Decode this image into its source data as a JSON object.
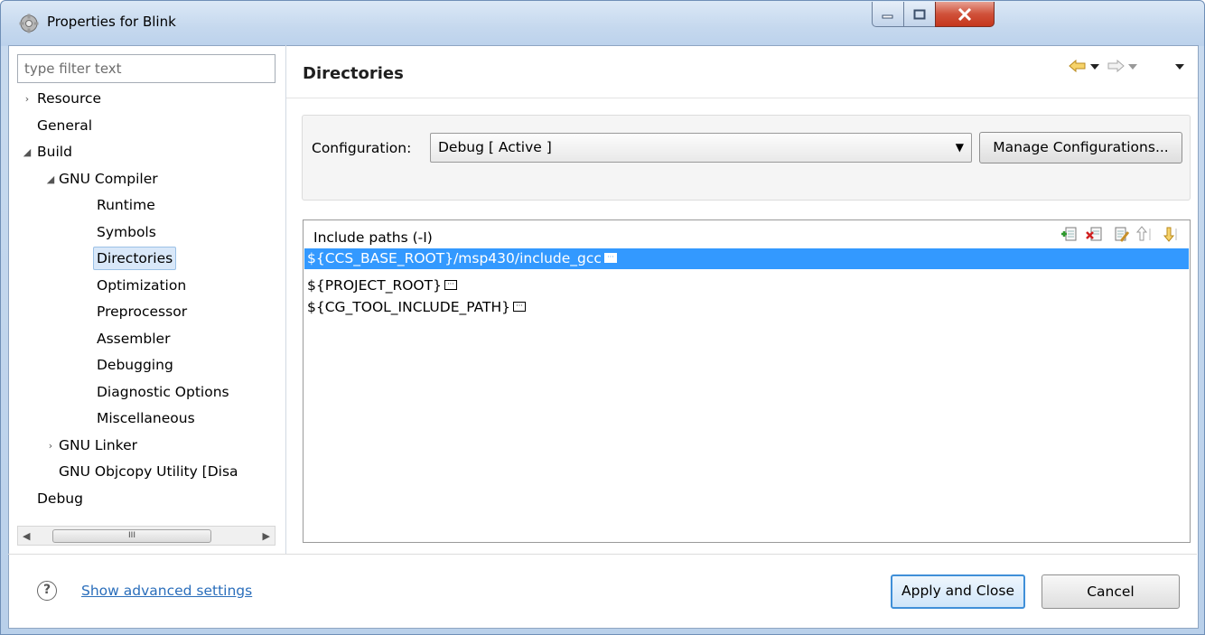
{
  "window": {
    "title": "Properties for Blink",
    "icons": {
      "app": "project-properties-icon",
      "minimize": "minimize-icon",
      "maximize": "maximize-icon",
      "close": "close-icon"
    }
  },
  "sidebar": {
    "filter_placeholder": "type filter text",
    "tree": [
      {
        "label": "Resource",
        "toggle": "›",
        "level": 0
      },
      {
        "label": "General",
        "toggle": "",
        "level": 0
      },
      {
        "label": "Build",
        "toggle": "◢",
        "level": 0
      },
      {
        "label": "GNU Compiler",
        "toggle": "◢",
        "level": 1
      },
      {
        "label": "Runtime",
        "toggle": "",
        "level": 2
      },
      {
        "label": "Symbols",
        "toggle": "",
        "level": 2
      },
      {
        "label": "Directories",
        "toggle": "",
        "level": 2,
        "selected": true
      },
      {
        "label": "Optimization",
        "toggle": "",
        "level": 2
      },
      {
        "label": "Preprocessor",
        "toggle": "",
        "level": 2
      },
      {
        "label": "Assembler",
        "toggle": "",
        "level": 2
      },
      {
        "label": "Debugging",
        "toggle": "",
        "level": 2
      },
      {
        "label": "Diagnostic Options",
        "toggle": "",
        "level": 2
      },
      {
        "label": "Miscellaneous",
        "toggle": "",
        "level": 2
      },
      {
        "label": "GNU Linker",
        "toggle": "›",
        "level": 1
      },
      {
        "label": "GNU Objcopy Utility  [Disa",
        "toggle": "",
        "level": 1
      },
      {
        "label": "Debug",
        "toggle": "",
        "level": 0
      }
    ],
    "scrollbar_grip": "III"
  },
  "main": {
    "title": "Directories",
    "nav_icons": [
      "back-arrow-icon",
      "back-dropdown-icon",
      "forward-arrow-icon",
      "forward-dropdown-icon",
      "view-menu-icon"
    ],
    "configuration": {
      "label": "Configuration:",
      "value": "Debug  [ Active ]",
      "manage_button": "Manage Configurations..."
    },
    "include_paths": {
      "header": "Include paths (-I)",
      "tool_icons": [
        "add-path-icon",
        "delete-path-icon",
        "edit-path-icon",
        "move-up-icon",
        "move-down-icon"
      ],
      "rows": [
        {
          "path": "${CCS_BASE_ROOT}/msp430/include_gcc",
          "selected": true
        },
        {
          "path": "${PROJECT_ROOT}",
          "selected": false
        },
        {
          "path": "${CG_TOOL_INCLUDE_PATH}",
          "selected": false
        }
      ]
    }
  },
  "footer": {
    "advanced_link": "Show advanced settings",
    "apply_button": "Apply and Close",
    "cancel_button": "Cancel"
  },
  "colors": {
    "selection": "#3399ff",
    "link": "#2a6ebb",
    "default_button_border": "#3f8fd8",
    "tree_selection": "#d9e8f9"
  }
}
